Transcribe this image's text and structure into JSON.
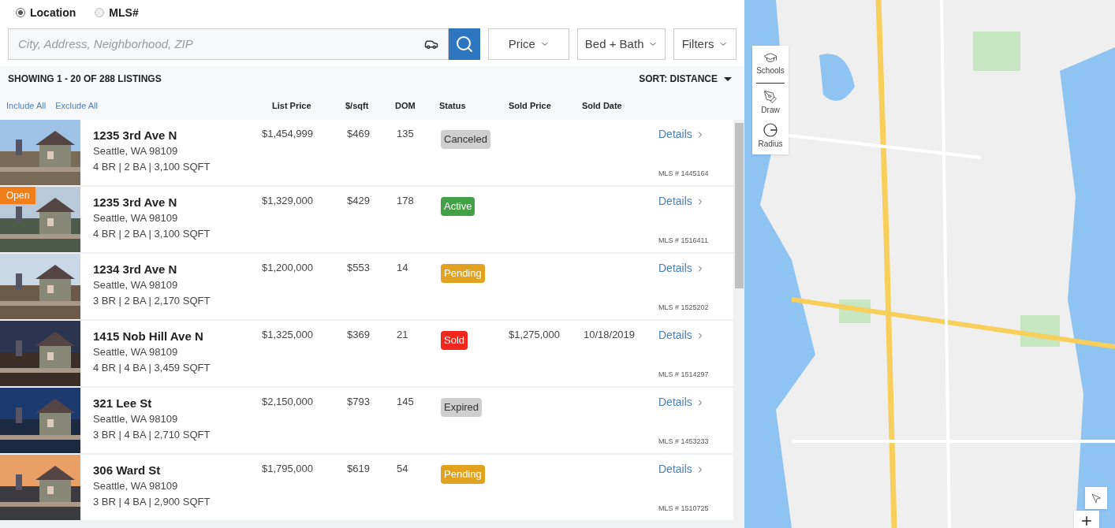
{
  "search_mode": [
    {
      "label": "Location",
      "selected": true
    },
    {
      "label": "MLS#",
      "selected": false
    }
  ],
  "search": {
    "placeholder": "City, Address, Neighborhood, ZIP"
  },
  "filters": [
    "Price",
    "Bed + Bath",
    "Filters"
  ],
  "summary": "SHOWING 1 - 20 OF 288 LISTINGS",
  "sort": "SORT: DISTANCE",
  "bulk_actions": [
    "Include All",
    "Exclude All"
  ],
  "columns": [
    "List Price",
    "$/sqft",
    "DOM",
    "Status",
    "Sold Price",
    "Sold Date"
  ],
  "listings": [
    {
      "address": "1235 3rd Ave N",
      "city": "Seattle, WA 98109",
      "specs": "4 BR | 2 BA | 3,100 SQFT",
      "price": "$1,454,999",
      "per_sqft": "$469",
      "dom": "135",
      "status": {
        "label": "Canceled",
        "kind": "canceled"
      },
      "details": "Details",
      "mls": "MLS # 1445164",
      "open_house": false
    },
    {
      "address": "1235 3rd Ave N",
      "city": "Seattle, WA 98109",
      "specs": "4 BR | 2 BA | 3,100 SQFT",
      "price": "$1,329,000",
      "per_sqft": "$429",
      "dom": "178",
      "status": {
        "label": "Active",
        "kind": "active"
      },
      "details": "Details",
      "mls": "MLS # 1516411",
      "open_house": true,
      "badge": "Open"
    },
    {
      "address": "1234 3rd Ave N",
      "city": "Seattle, WA 98109",
      "specs": "3 BR | 2 BA | 2,170 SQFT",
      "price": "$1,200,000",
      "per_sqft": "$553",
      "dom": "14",
      "status": {
        "label": "Pending",
        "kind": "pending"
      },
      "details": "Details",
      "mls": "MLS # 1525202",
      "open_house": false
    },
    {
      "address": "1415 Nob Hill Ave N",
      "city": "Seattle, WA 98109",
      "specs": "4 BR | 4 BA | 3,459 SQFT",
      "price": "$1,325,000",
      "per_sqft": "$369",
      "dom": "21",
      "status": {
        "label": "Sold",
        "kind": "sold"
      },
      "sold_price": "$1,275,000",
      "sold_date": "10/18/2019",
      "details": "Details",
      "mls": "MLS # 1514297",
      "open_house": false
    },
    {
      "address": "321 Lee St",
      "city": "Seattle, WA 98109",
      "specs": "3 BR | 4 BA | 2,710 SQFT",
      "price": "$2,150,000",
      "per_sqft": "$793",
      "dom": "145",
      "status": {
        "label": "Expired",
        "kind": "expired"
      },
      "details": "Details",
      "mls": "MLS # 1453233",
      "open_house": false
    },
    {
      "address": "306 Ward St",
      "city": "Seattle, WA 98109",
      "specs": "3 BR | 4 BA | 2,900 SQFT",
      "price": "$1,795,000",
      "per_sqft": "$619",
      "dom": "54",
      "status": {
        "label": "Pending",
        "kind": "pending"
      },
      "details": "Details",
      "mls": "MLS # 1510725",
      "open_house": false
    }
  ],
  "map_tools": [
    "Schools",
    "Draw",
    "Radius"
  ]
}
